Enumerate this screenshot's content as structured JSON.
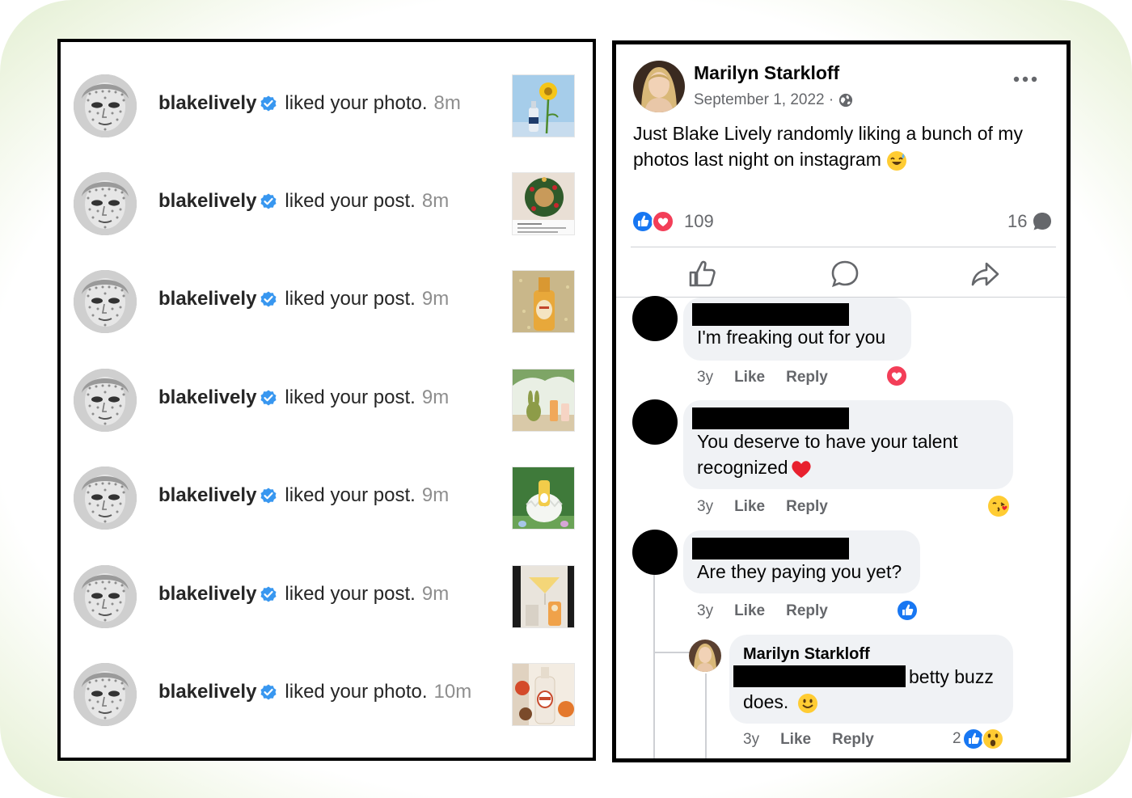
{
  "instagram": {
    "notifications": [
      {
        "user": "blakelively",
        "action": "liked your photo.",
        "time": "8m",
        "thumb": "flower-bottle"
      },
      {
        "user": "blakelively",
        "action": "liked your post.",
        "time": "8m",
        "thumb": "wreath"
      },
      {
        "user": "blakelively",
        "action": "liked your post.",
        "time": "9m",
        "thumb": "gold-bottle"
      },
      {
        "user": "blakelively",
        "action": "liked your post.",
        "time": "9m",
        "thumb": "bunny-drinks"
      },
      {
        "user": "blakelively",
        "action": "liked your post.",
        "time": "9m",
        "thumb": "egg"
      },
      {
        "user": "blakelively",
        "action": "liked your post.",
        "time": "9m",
        "thumb": "cocktail"
      },
      {
        "user": "blakelively",
        "action": "liked your photo.",
        "time": "10m",
        "thumb": "bottle-apples"
      }
    ]
  },
  "facebook": {
    "author": "Marilyn Starkloff",
    "date": "September 1, 2022 ·",
    "post_text": "Just Blake Lively randomly liking a bunch of my photos last night on instagram",
    "reaction_count": "109",
    "comment_count": "16",
    "comments": [
      {
        "text": "I'm freaking out for you",
        "age": "3y",
        "like": "Like",
        "reply": "Reply",
        "reaction": "love"
      },
      {
        "text_line1": "You deserve to have your talent",
        "text_line2": "recognized",
        "age": "3y",
        "like": "Like",
        "reply": "Reply",
        "reaction": "kiss"
      },
      {
        "text": "Are they paying you yet?",
        "age": "3y",
        "like": "Like",
        "reply": "Reply",
        "reaction": "like"
      }
    ],
    "reply": {
      "name": "Marilyn Starkloff",
      "text_after_redaction": "betty buzz",
      "text_line2": "does.",
      "age": "3y",
      "like": "Like",
      "reply": "Reply",
      "reaction_count": "2"
    },
    "colors": {
      "like_blue": "#1877f2",
      "love_red": "#f33e58",
      "meta_gray": "#65676b",
      "bubble": "#f0f2f5"
    }
  }
}
